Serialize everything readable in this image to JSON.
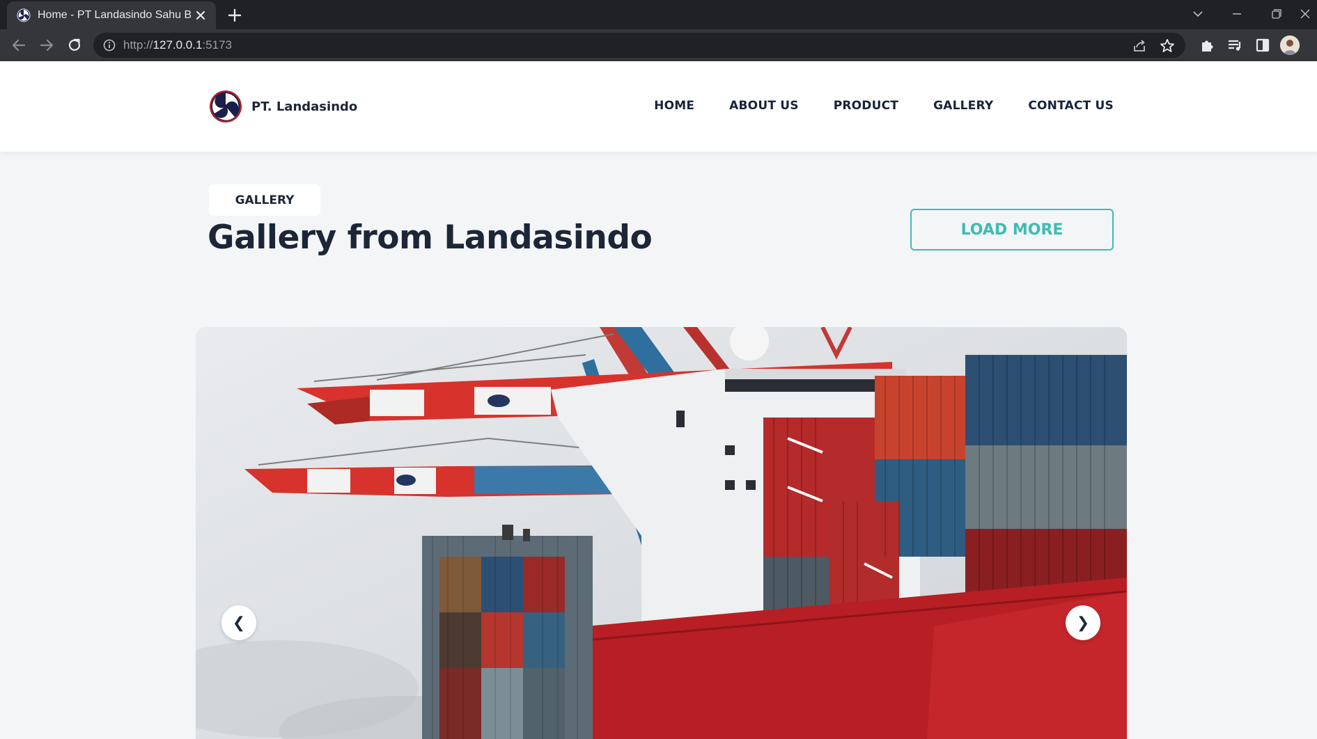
{
  "browser": {
    "tab_title": "Home - PT Landasindo Sahu Bandar",
    "url_scheme": "http://",
    "url_host": "127.0.0.1",
    "url_port": ":5173"
  },
  "header": {
    "brand_name": "PT. Landasindo",
    "nav": [
      "HOME",
      "ABOUT US",
      "PRODUCT",
      "GALLERY",
      "CONTACT US"
    ]
  },
  "gallery": {
    "badge": "GALLERY",
    "title": "Gallery from Landasindo",
    "load_more_label": "LOAD MORE",
    "prev_label": "❮",
    "next_label": "❯"
  },
  "colors": {
    "accent": "#3dbcb3",
    "text_dark": "#1c2636",
    "page_bg": "#f3f5f7",
    "chrome_dark": "#202124",
    "chrome_mid": "#35363a"
  },
  "icons": [
    "tab-favicon-icon",
    "close-icon",
    "plus-icon",
    "chevron-down-icon",
    "minimize-icon",
    "restore-icon",
    "close-window-icon",
    "back-arrow-icon",
    "forward-arrow-icon",
    "reload-icon",
    "info-icon",
    "share-icon",
    "star-icon",
    "extensions-icon",
    "media-queue-icon",
    "side-panel-icon",
    "profile-avatar",
    "company-logo-icon"
  ]
}
